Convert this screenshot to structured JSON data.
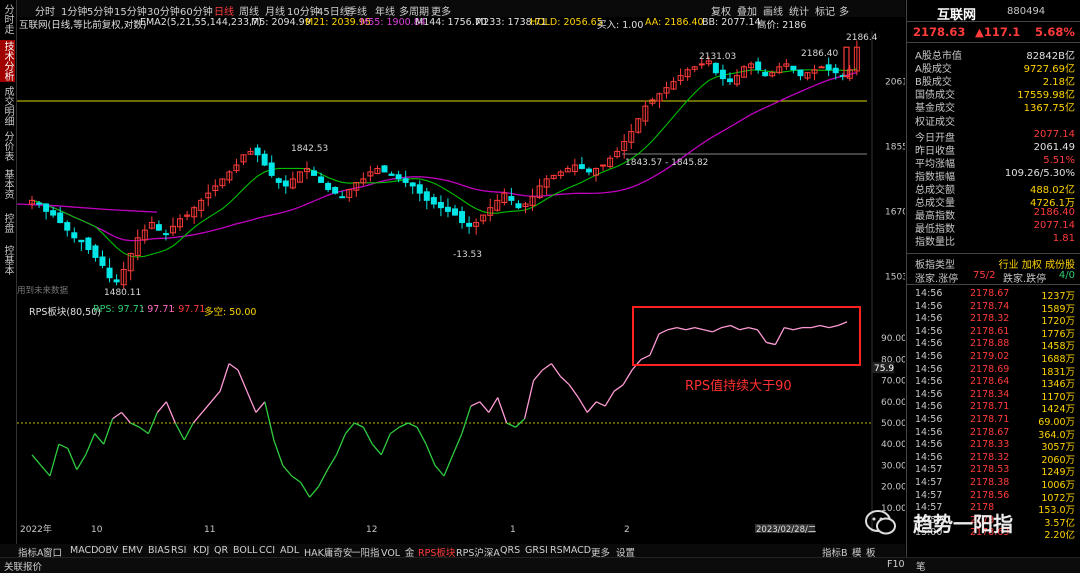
{
  "left_nav": [
    {
      "label": "分时走势",
      "active": false
    },
    {
      "label": "技术分析",
      "active": true
    },
    {
      "label": "成交明细",
      "active": false
    },
    {
      "label": "分价表",
      "active": false
    },
    {
      "label": "基本资料",
      "active": false
    },
    {
      "label": "控盘",
      "active": false
    },
    {
      "label": "控基本",
      "active": false
    }
  ],
  "toolbar": {
    "periods": [
      "分时",
      "1分钟",
      "5分钟",
      "15分钟",
      "30分钟",
      "60分钟",
      "日线",
      "周线",
      "月线",
      "10分钟",
      "45日线",
      "季线",
      "年线",
      "多周期",
      "更多"
    ],
    "active_period": "日线",
    "right_items": [
      "复权",
      "叠加",
      "画线",
      "统计",
      "标记",
      "多"
    ]
  },
  "infobar": {
    "name": "互联网(日线,等比前复权,对数)",
    "ema": "EMA2(5,21,55,144,233,7)",
    "m5": "M5: 2094.99",
    "m21": "M21: 2039.95",
    "m55": "M55: 1900.84",
    "m144": "M144: 1756.70",
    "m233": "M233: 1738.71",
    "hold": "HOLD: 2056.65",
    "buy": "买入: 1.00",
    "aa": "AA: 2186.40",
    "bb": "BB: 2077.14",
    "high": "高价: 2186"
  },
  "main_chart": {
    "price_ticks": [
      "2061",
      "1855",
      "1670",
      "1503"
    ],
    "annotations": [
      "1842.53",
      "2131.03",
      "2186.40",
      "2186.4",
      "1843.57 - 1845.82",
      "-13.53",
      "1480.11"
    ],
    "watermark": "用到未来数据"
  },
  "sub_chart": {
    "title": "RPS板块(80,50)",
    "rps_label": "RPS: 97.71",
    "v2": ": 97.71",
    "v3": ": 97.71",
    "duokong": "多空: 50.00",
    "ticks": [
      "90.00",
      "80.00",
      "75.9",
      "70.00",
      "60.00",
      "50.00",
      "40.00",
      "30.00",
      "20.00",
      "10.00"
    ],
    "callout": "RPS值持续大于90"
  },
  "chart_data": [
    {
      "type": "line",
      "title": "RPS板块(80,50)",
      "series": [
        {
          "name": "RPS",
          "values": [
            35,
            30,
            25,
            40,
            38,
            28,
            35,
            45,
            40,
            52,
            55,
            50,
            48,
            45,
            55,
            60,
            50,
            42,
            50,
            55,
            60,
            65,
            78,
            75,
            65,
            55,
            60,
            42,
            30,
            25,
            22,
            15,
            20,
            28,
            35,
            45,
            50,
            48,
            40,
            35,
            45,
            48,
            50,
            48,
            40,
            30,
            25,
            35,
            45,
            58,
            60,
            55,
            62,
            50,
            48,
            52,
            70,
            75,
            78,
            72,
            68,
            62,
            55,
            60,
            58,
            65,
            68,
            75,
            80,
            82,
            92,
            94,
            95,
            94,
            95,
            94,
            93,
            95,
            96,
            94,
            95,
            94,
            88,
            87,
            95,
            94,
            95,
            95,
            96,
            95,
            96,
            97.71
          ]
        }
      ],
      "ylim": [
        0,
        100
      ]
    }
  ],
  "bottom_tabs": {
    "items": [
      "指标A",
      "窗口",
      "MACD",
      "OBV",
      "EMV",
      "BIAS",
      "RSI",
      "KDJ",
      "QR",
      "BOLL",
      "CCI",
      "ADL",
      "HAK庸奇安",
      "一阳指",
      "VOL_金",
      "RPS板块",
      "RPS沪深A",
      "QRS",
      "GRSI",
      "RSMACD",
      "更多",
      "设置"
    ],
    "active": "RPS板块",
    "right": [
      "指标B",
      "模",
      "板"
    ],
    "x_labels": [
      "2022年",
      "10",
      "11",
      "12",
      "1",
      "2"
    ],
    "date_label": "2023/02/28/二"
  },
  "status": {
    "left": "关联报价",
    "right": "F10"
  },
  "rpanel": {
    "name": "互联网",
    "code": "880494",
    "price": "2178.63",
    "change": "▲117.1",
    "pct": "5.68%",
    "stats": [
      {
        "k": "A股总市值",
        "v": "82842B亿",
        "c": "wh"
      },
      {
        "k": "A股成交",
        "v": "9727.69亿",
        "c": "yel"
      },
      {
        "k": "B股成交",
        "v": "2.18亿",
        "c": "yel"
      },
      {
        "k": "国债成交",
        "v": "17559.98亿",
        "c": "yel"
      },
      {
        "k": "基金成交",
        "v": "1367.75亿",
        "c": "yel"
      },
      {
        "k": "权证成交",
        "v": "",
        "c": "yel"
      },
      {
        "k": "今日开盘",
        "v": "2077.14",
        "c": "red"
      },
      {
        "k": "昨日收盘",
        "v": "2061.49",
        "c": "wh"
      },
      {
        "k": "平均涨幅",
        "v": "5.51%",
        "c": "red"
      },
      {
        "k": "指数振幅",
        "v": "109.26/5.30%",
        "c": "wh"
      },
      {
        "k": "总成交额",
        "v": "488.02亿",
        "c": "yel"
      },
      {
        "k": "总成交量",
        "v": "4726.1万",
        "c": "yel"
      },
      {
        "k": "最高指数",
        "v": "2186.40",
        "c": "red"
      },
      {
        "k": "最低指数",
        "v": "2077.14",
        "c": "red"
      },
      {
        "k": "指数量比",
        "v": "1.81",
        "c": "red"
      }
    ],
    "board_label": "板指类型",
    "board_value": "行业 加权 成份股",
    "updown": {
      "label1": "涨家.涨停",
      "val1": "75/2",
      "label2": "跌家.跌停",
      "val2": "4/0"
    },
    "ticks": [
      {
        "t": "14:56",
        "p": "2178.67",
        "q": "1237万"
      },
      {
        "t": "14:56",
        "p": "2178.74",
        "q": "1589万"
      },
      {
        "t": "14:56",
        "p": "2178.32",
        "q": "1720万"
      },
      {
        "t": "14:56",
        "p": "2178.61",
        "q": "1776万"
      },
      {
        "t": "14:56",
        "p": "2178.88",
        "q": "1458万"
      },
      {
        "t": "14:56",
        "p": "2179.02",
        "q": "1688万"
      },
      {
        "t": "14:56",
        "p": "2178.69",
        "q": "1831万"
      },
      {
        "t": "14:56",
        "p": "2178.64",
        "q": "1346万"
      },
      {
        "t": "14:56",
        "p": "2178.34",
        "q": "1170万"
      },
      {
        "t": "14:56",
        "p": "2178.71",
        "q": "1424万"
      },
      {
        "t": "14:56",
        "p": "2178.71",
        "q": "69.00万"
      },
      {
        "t": "14:56",
        "p": "2178.67",
        "q": "364.0万"
      },
      {
        "t": "14:56",
        "p": "2178.33",
        "q": "3057万"
      },
      {
        "t": "14:56",
        "p": "2178.32",
        "q": "2060万"
      },
      {
        "t": "14:57",
        "p": "2178.53",
        "q": "1249万"
      },
      {
        "t": "14:57",
        "p": "2178.38",
        "q": "1006万"
      },
      {
        "t": "14:57",
        "p": "2178.56",
        "q": "1072万"
      },
      {
        "t": "14:57",
        "p": "2178",
        "q": "153.0万"
      },
      {
        "t": "14:57",
        "p": "2178",
        "q": "3.57亿"
      },
      {
        "t": "15:00",
        "p": "2178.63",
        "q": "2.20亿"
      }
    ],
    "watermark": "趋势一阳指",
    "footer_right": "笔"
  }
}
